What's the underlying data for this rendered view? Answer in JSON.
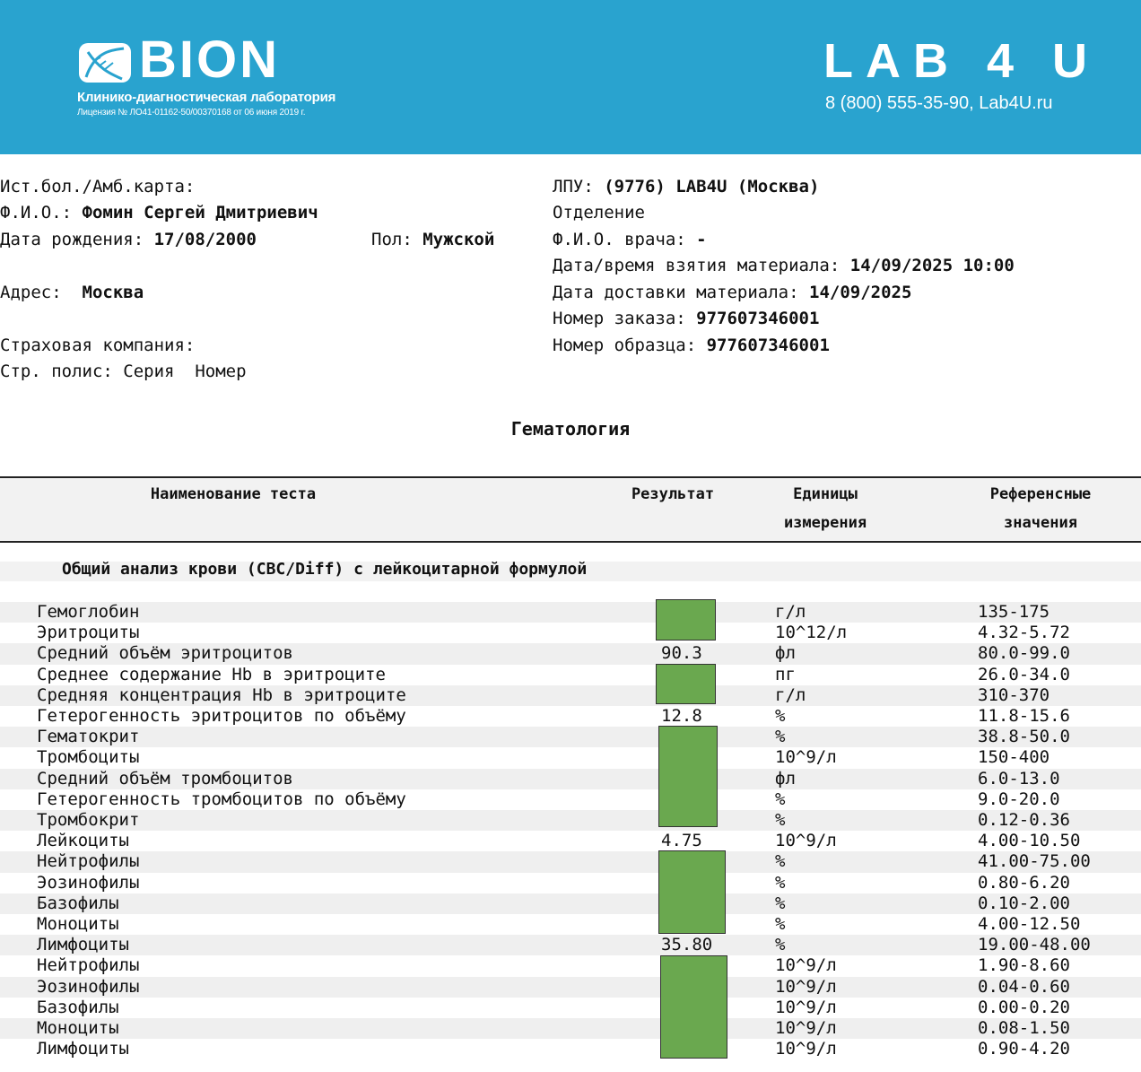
{
  "header": {
    "brand": "BION",
    "brand_subtitle": "Клинико-диагностическая лаборатория",
    "license": "Лицензия № ЛО41-01162-50/00370168 от 06 июня 2019 г.",
    "partner": "LAB 4 U",
    "partner_contact": "8 (800) 555-35-90, Lab4U.ru",
    "color": "#29a3cf"
  },
  "patient": {
    "card_label": "Ист.бол./Амб.карта:",
    "fio_label": "Ф.И.О.:",
    "fio": "Фомин Сергей Дмитриевич",
    "dob_label": "Дата рождения:",
    "dob": "17/08/2000",
    "sex_label": "Пол:",
    "sex": "Мужской",
    "address_label": "Адрес:",
    "address": "Москва",
    "insurance_label": "Страховая компания:",
    "policy_label": "Стр. полис: Серия",
    "policy_number_label": "Номер"
  },
  "order": {
    "lpu_label": "ЛПУ:",
    "lpu": "(9776) LAB4U (Москва)",
    "department_label": "Отделение",
    "doctor_label": "Ф.И.О. врача:",
    "doctor": "-",
    "collected_label": "Дата/время взятия материала:",
    "collected": "14/09/2025 10:00",
    "delivered_label": "Дата доставки материала:",
    "delivered": "14/09/2025",
    "order_no_label": "Номер заказа:",
    "order_no": "977607346001",
    "sample_no_label": "Номер образца:",
    "sample_no": "977607346001"
  },
  "section": "Гематология",
  "table": {
    "col_name": "Наименование теста",
    "col_result": "Результат",
    "col_units_1": "Единицы",
    "col_units_2": "измерения",
    "col_ref_1": "Референсные",
    "col_ref_2": "значения",
    "group": "Общий анализ крови (CBC/Diff) с лейкоцитарной формулой",
    "mask_color": "#6aa84f",
    "rows": [
      {
        "name": "Гемоглобин",
        "result": "",
        "unit": "г/л",
        "ref": "135-175"
      },
      {
        "name": "Эритроциты",
        "result": "",
        "unit": "10^12/л",
        "ref": "4.32-5.72"
      },
      {
        "name": "Средний объём эритроцитов",
        "result": "90.3",
        "unit": "фл",
        "ref": "80.0-99.0"
      },
      {
        "name": "Среднее содержание Hb в эритроците",
        "result": "",
        "unit": "пг",
        "ref": "26.0-34.0"
      },
      {
        "name": "Средняя концентрация Hb в эритроците",
        "result": "",
        "unit": "г/л",
        "ref": "310-370"
      },
      {
        "name": "Гетерогенность эритроцитов по объёму",
        "result": "12.8",
        "unit": "%",
        "ref": "11.8-15.6"
      },
      {
        "name": "Гематокрит",
        "result": "",
        "unit": "%",
        "ref": "38.8-50.0"
      },
      {
        "name": "Тромбоциты",
        "result": "",
        "unit": "10^9/л",
        "ref": "150-400"
      },
      {
        "name": "Средний объём тромбоцитов",
        "result": "",
        "unit": "фл",
        "ref": "6.0-13.0"
      },
      {
        "name": "Гетерогенность тромбоцитов по объёму",
        "result": "",
        "unit": "%",
        "ref": "9.0-20.0"
      },
      {
        "name": "Тромбокрит",
        "result": "",
        "unit": "%",
        "ref": "0.12-0.36"
      },
      {
        "name": "Лейкоциты",
        "result": "4.75",
        "unit": "10^9/л",
        "ref": "4.00-10.50"
      },
      {
        "name": "Нейтрофилы",
        "result": "",
        "unit": "%",
        "ref": "41.00-75.00"
      },
      {
        "name": "Эозинофилы",
        "result": "",
        "unit": "%",
        "ref": "0.80-6.20"
      },
      {
        "name": "Базофилы",
        "result": "",
        "unit": "%",
        "ref": "0.10-2.00"
      },
      {
        "name": "Моноциты",
        "result": "",
        "unit": "%",
        "ref": "4.00-12.50"
      },
      {
        "name": "Лимфоциты",
        "result": "35.80",
        "unit": "%",
        "ref": "19.00-48.00"
      },
      {
        "name": "Нейтрофилы",
        "result": "",
        "unit": "10^9/л",
        "ref": "1.90-8.60"
      },
      {
        "name": "Эозинофилы",
        "result": "",
        "unit": "10^9/л",
        "ref": "0.04-0.60"
      },
      {
        "name": "Базофилы",
        "result": "",
        "unit": "10^9/л",
        "ref": "0.00-0.20"
      },
      {
        "name": "Моноциты",
        "result": "",
        "unit": "10^9/л",
        "ref": "0.08-1.50"
      },
      {
        "name": "Лимфоциты",
        "result": "",
        "unit": "10^9/л",
        "ref": "0.90-4.20"
      }
    ]
  }
}
